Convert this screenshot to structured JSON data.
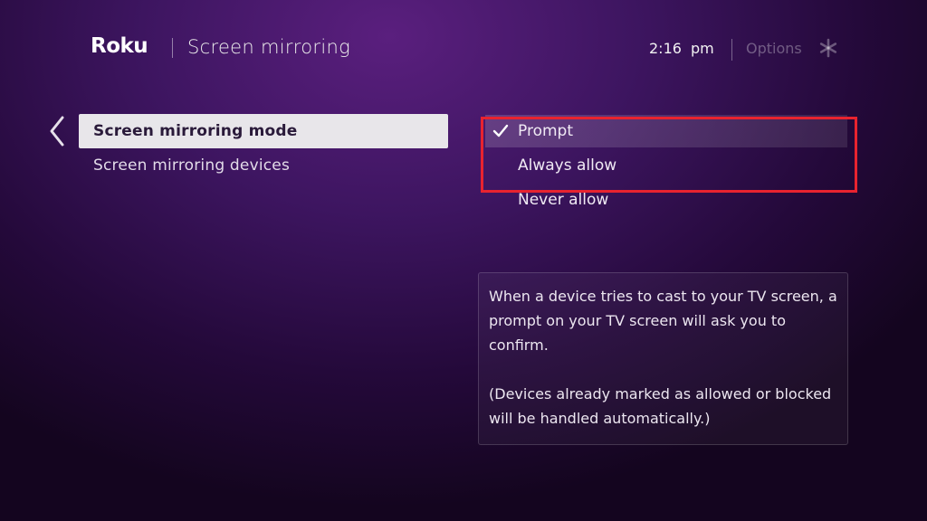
{
  "header": {
    "logo_text": "Roku",
    "title": "Screen mirroring",
    "time": "2:16",
    "ampm": "pm",
    "options_label": "Options"
  },
  "sidebar": {
    "items": [
      {
        "label": "Screen mirroring mode",
        "selected": true
      },
      {
        "label": "Screen mirroring devices",
        "selected": false
      }
    ]
  },
  "options": {
    "items": [
      {
        "label": "Prompt",
        "checked": true
      },
      {
        "label": "Always allow",
        "checked": false
      },
      {
        "label": "Never allow",
        "checked": false
      }
    ]
  },
  "help": {
    "paragraph1": "When a device tries to cast to your TV screen, a prompt on your TV screen will ask you to confirm.",
    "paragraph2": "(Devices already marked as allowed or blocked will be handled automatically.)"
  },
  "icons": {
    "back": "chevron-left-icon",
    "options": "asterisk-icon",
    "check": "checkmark-icon"
  },
  "colors": {
    "highlight_border": "#e8232f",
    "selected_background": "#e8e6ea",
    "background": "#3d1560"
  }
}
